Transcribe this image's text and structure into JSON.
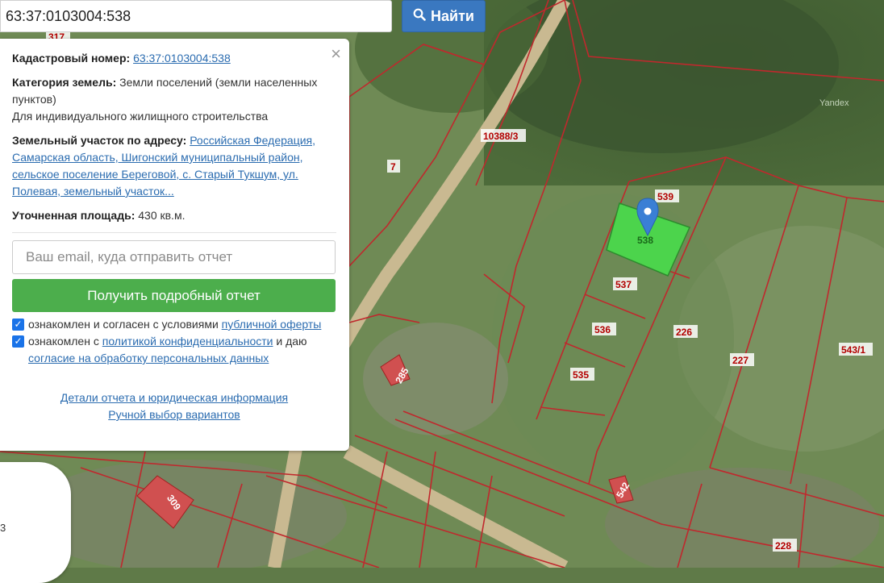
{
  "search": {
    "value": "63:37:0103004:538",
    "button_label": "Найти"
  },
  "info": {
    "cadastral_label": "Кадастровый номер:",
    "cadastral_value": "63:37:0103004:538",
    "category_label": "Категория земель:",
    "category_value": "Земли поселений (земли населенных пунктов)",
    "usage": "Для индивидуального жилищного строительства",
    "address_label": "Земельный участок по адресу:",
    "address_value": "Российская Федерация, Самарская область, Шигонский муниципальный район, сельское поселение Береговой, с. Старый Тукшум, ул. Полевая, земельный участок...",
    "area_label": "Уточненная площадь:",
    "area_value": "430 кв.м.",
    "email_placeholder": "Ваш email, куда отправить отчет",
    "report_button": "Получить подробный отчет",
    "consent1_text": "ознакомлен и согласен с условиями",
    "consent1_link": "публичной оферты",
    "consent2_text": "ознакомлен с",
    "consent2_link1": "политикой конфиденциальности",
    "consent2_and": "и даю",
    "consent2_link2": "согласие на обработку персональных данных",
    "details_link": "Детали отчета и юридическая информация",
    "manual_link": "Ручной выбор вариантов",
    "close_icon": "×"
  },
  "map": {
    "attribution": "Yandex",
    "selected_parcel": "538",
    "parcel_labels": [
      "539",
      "538",
      "537",
      "536",
      "535",
      "226",
      "227",
      "543/1",
      "7",
      "10388/3",
      "285",
      "309",
      "542",
      "228",
      "317"
    ],
    "card2_text": "3"
  },
  "colors": {
    "selected": "#4cd44c",
    "boundary": "#c0282d",
    "marker": "#3a7fd5",
    "button": "#3a78c0",
    "report": "#4cae4c"
  }
}
